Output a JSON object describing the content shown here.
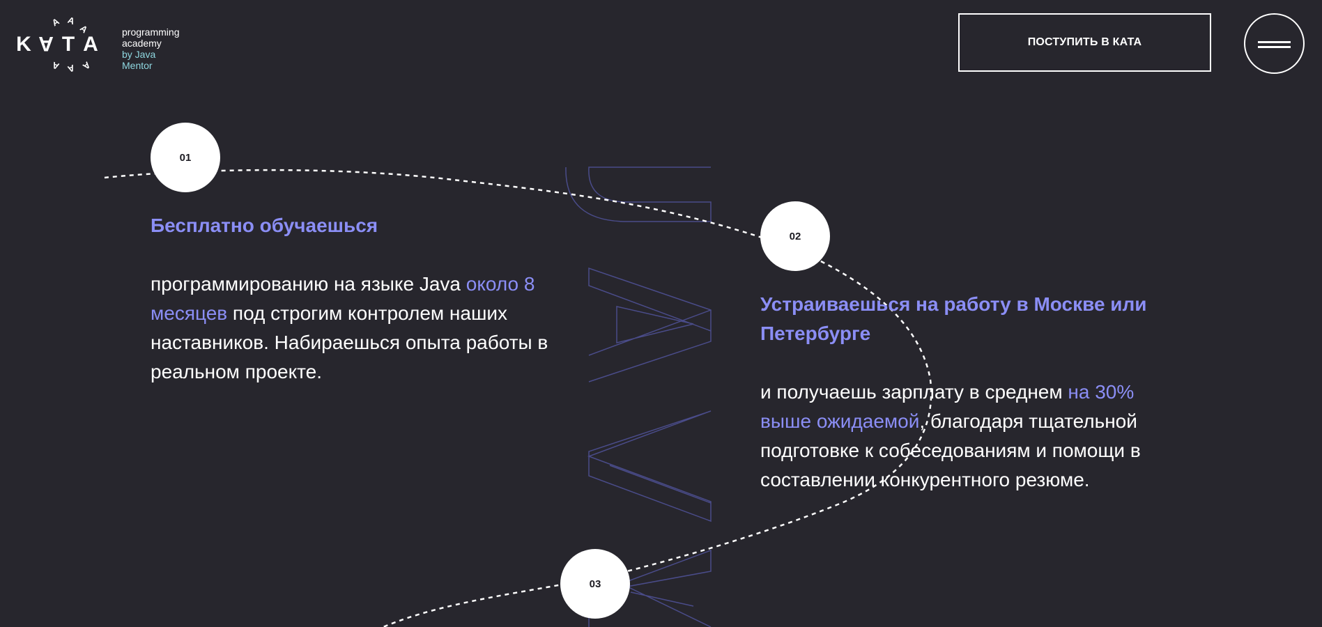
{
  "header": {
    "logo": {
      "letters": [
        "K",
        "A",
        "T",
        "A"
      ],
      "line1": "programming",
      "line2": "academy",
      "line3": "by Java Mentor"
    },
    "cta_label": "ПОСТУПИТЬ В КАТА"
  },
  "watermark_text": "JAVA",
  "steps": [
    {
      "number": "01",
      "title": "Бесплатно обучаешься",
      "text_before": "программированию на языке Java ",
      "highlight": "около 8 месяцев",
      "text_after": " под строгим контролем наших наставников. Набираешься опыта работы в реальном проекте."
    },
    {
      "number": "02",
      "title": "Устраиваешься на работу в Москве или Петербурге",
      "text_before": "и получаешь зарплату в среднем ",
      "highlight": "на 30% выше ожидаемой",
      "text_after": ", благодаря тщательной подготовке к собеседованиям и помощи в составлении конкурентного резюме."
    },
    {
      "number": "03"
    }
  ],
  "colors": {
    "background": "#27262d",
    "accent": "#8b8ef5",
    "logo_accent": "#8fd7e0",
    "outline": "#4a4c8a"
  }
}
